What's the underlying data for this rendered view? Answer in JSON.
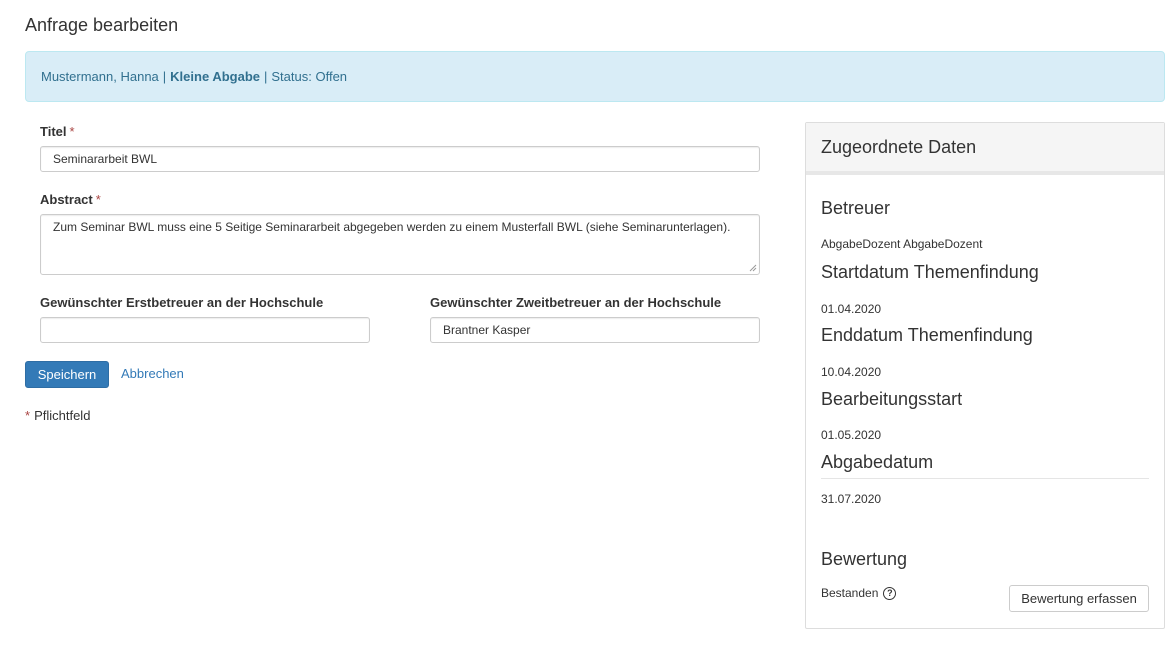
{
  "page": {
    "title": "Anfrage bearbeiten"
  },
  "banner": {
    "name": "Mustermann, Hanna",
    "separator1": "|",
    "type": "Kleine Abgabe",
    "separator2": "|",
    "status": "Status: Offen"
  },
  "form": {
    "title": {
      "label": "Titel",
      "required_mark": "*",
      "value": "Seminararbeit BWL"
    },
    "abstract": {
      "label": "Abstract",
      "required_mark": "*",
      "value": "Zum Seminar BWL muss eine 5 Seitige Seminararbeit abgegeben werden zu einem Musterfall BWL (siehe Seminarunterlagen)."
    },
    "first_supervisor": {
      "label": "Gewünschter Erstbetreuer an der Hochschule",
      "value": ""
    },
    "second_supervisor": {
      "label": "Gewünschter Zweitbetreuer an der Hochschule",
      "value": "Brantner Kasper"
    },
    "save_label": "Speichern",
    "cancel_label": "Abbrechen",
    "required_note": {
      "mark": "*",
      "text": "Pflichtfeld"
    }
  },
  "panel": {
    "heading": "Zugeordnete Daten",
    "sections": [
      {
        "title": "Betreuer",
        "value": "AbgabeDozent AbgabeDozent"
      },
      {
        "title": "Startdatum Themenfindung",
        "value": "01.04.2020"
      },
      {
        "title": "Enddatum Themenfindung",
        "value": "10.04.2020"
      },
      {
        "title": "Bearbeitungsstart",
        "value": "01.05.2020"
      },
      {
        "title": "Abgabedatum",
        "value": "31.07.2020"
      }
    ],
    "grading": {
      "title": "Bewertung",
      "value": "Bestanden",
      "help_glyph": "?",
      "button_label": "Bewertung erfassen"
    }
  },
  "colors": {
    "primary": "#337ab7",
    "banner_bg": "#d9edf7",
    "banner_text": "#31708f",
    "required": "#a94442"
  }
}
